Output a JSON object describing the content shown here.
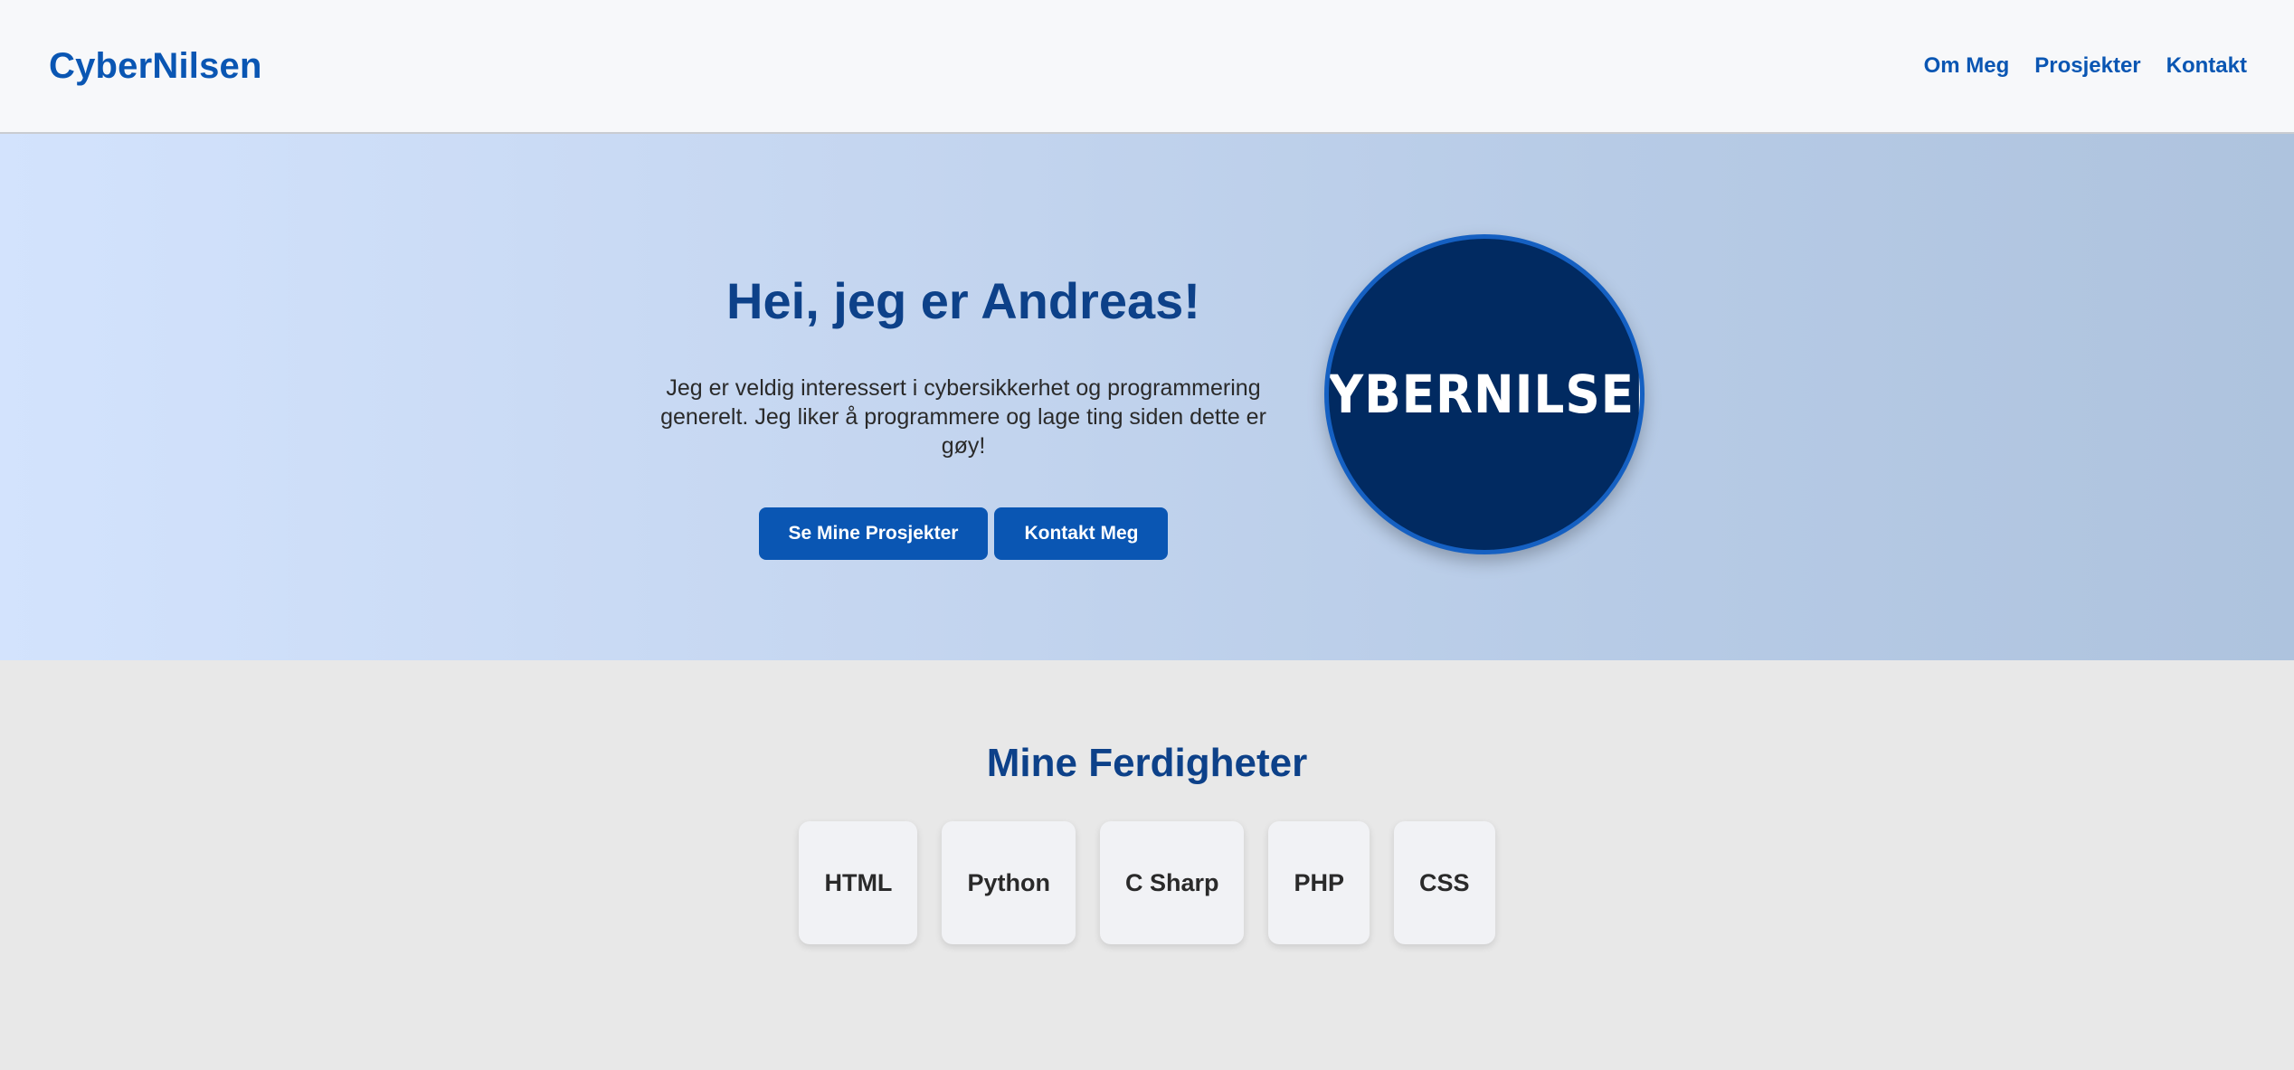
{
  "navbar": {
    "brand": "CyberNilsen",
    "links": [
      "Om Meg",
      "Prosjekter",
      "Kontakt"
    ]
  },
  "hero": {
    "title": "Hei, jeg er Andreas!",
    "description": "Jeg er veldig interessert i cybersikkerhet og programmering generelt. Jeg liker å programmere og lage ting siden dette er gøy!",
    "buttons": [
      "Se Mine Prosjekter",
      "Kontakt Meg"
    ],
    "logo_text": "CYBERNILSEN"
  },
  "skills": {
    "title": "Mine Ferdigheter",
    "items": [
      "HTML",
      "Python",
      "C Sharp",
      "PHP",
      "CSS"
    ]
  },
  "colors": {
    "brand_blue": "#0a56b3",
    "heading_blue": "#0d4189",
    "logo_navy": "#012a61"
  }
}
